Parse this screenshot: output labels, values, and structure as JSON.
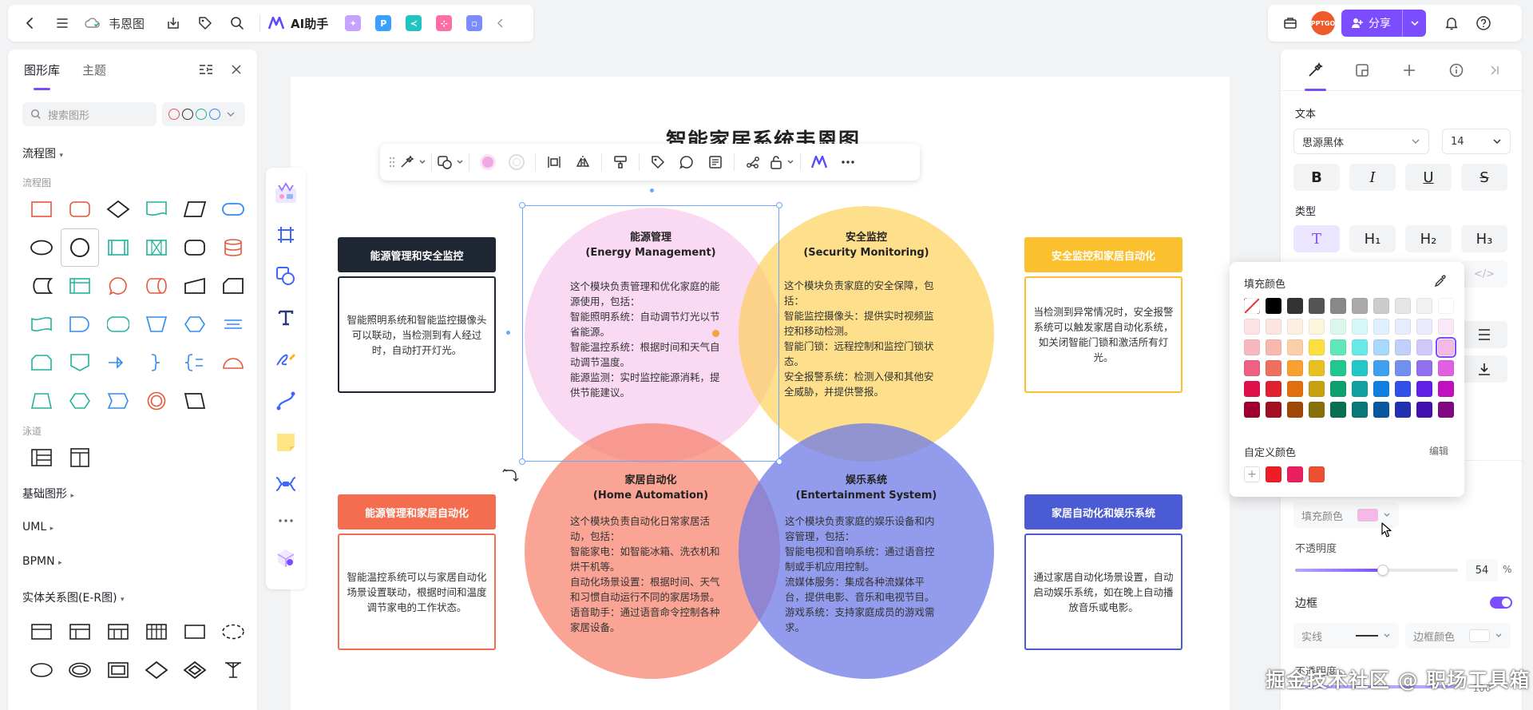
{
  "topbar": {
    "doc_title": "韦恩图",
    "ai_label": "AI助手"
  },
  "share": {
    "label": "分享"
  },
  "avatar": {
    "text": "PPTGO"
  },
  "left_panel": {
    "tabs": [
      "图形库",
      "主题"
    ],
    "search_placeholder": "搜索图形",
    "sections": {
      "flowchart": "流程图",
      "flowchart_sub": "流程图",
      "swimlane": "泳道",
      "basic": "基础图形",
      "uml": "UML",
      "bpmn": "BPMN",
      "er": "实体关系图(E-R图)"
    }
  },
  "diagram": {
    "title": "智能家居系统韦恩图",
    "circles": {
      "energy": {
        "title": "能源管理",
        "subtitle": "(Energy Management)",
        "lines": [
          "这个模块负责管理和优化家庭的能",
          "源使用，包括：",
          "智能照明系统：自动调节灯光以节",
          "省能源。",
          "智能温控系统：根据时间和天气自",
          "动调节温度。",
          "能源监测：实时监控能源消耗，提",
          "供节能建议。"
        ]
      },
      "security": {
        "title": "安全监控",
        "subtitle": "(Security Monitoring)",
        "lines": [
          "这个模块负责家庭的安全保障，包",
          "括：",
          "智能监控摄像头：提供实时视频监",
          "控和移动检测。",
          "智能门锁：远程控制和监控门锁状",
          "态。",
          "安全报警系统：检测入侵和其他安",
          "全威胁，并提供警报。"
        ]
      },
      "home": {
        "title": "家居自动化",
        "subtitle": "(Home Automation)",
        "lines": [
          "这个模块负责自动化日常家居活",
          "动，包括：",
          "智能家电：如智能冰箱、洗衣机和",
          "烘干机等。",
          "自动化场景设置：根据时间、天气",
          "和习惯自动运行不同的家居场景。",
          "语音助手：通过语音命令控制各种",
          "家居设备。"
        ]
      },
      "entertainment": {
        "title": "娱乐系统",
        "subtitle": "(Entertainment System)",
        "lines": [
          "这个模块负责家庭的娱乐设备和内",
          "容管理，包括：",
          "智能电视和音响系统：通过语音控",
          "制或手机应用控制。",
          "流媒体服务：集成各种流媒体平",
          "台，提供电影、音乐和电视节目。",
          "游戏系统：支持家庭成员的游戏需",
          "求。"
        ]
      }
    },
    "cards": {
      "tl": {
        "header": "能源管理和安全监控",
        "lines": [
          "智能照明系统和智能监控摄像头",
          "可以联动，当检测到有人经过",
          "时，自动打开灯光。"
        ]
      },
      "tr": {
        "header": "安全监控和家居自动化",
        "lines": [
          "当检测到异常情况时，安全报警",
          "系统可以触发家居自动化系统，",
          "如关闭智能门锁和激活所有灯",
          "光。"
        ]
      },
      "bl": {
        "header": "能源管理和家居自动化",
        "lines": [
          "智能温控系统可以与家居自动化",
          "场景设置联动，根据时间和温度",
          "调节家电的工作状态。"
        ]
      },
      "br": {
        "header": "家居自动化和娱乐系统",
        "lines": [
          "通过家居自动化场景设置，自动",
          "启动娱乐系统，如在晚上自动播",
          "放音乐或电影。"
        ]
      }
    }
  },
  "right_panel": {
    "text_label": "文本",
    "font_family": "思源黑体",
    "font_size": "14",
    "type_label": "类型",
    "type_buttons": [
      "T",
      "H₁",
      "H₂",
      "H₃"
    ],
    "fill_color_label": "填充颜色",
    "opacity_label": "不透明度",
    "opacity_value": "54",
    "opacity_unit": "%",
    "opacity_fraction": 0.54,
    "border_label": "边框",
    "border_style": "实线",
    "border_color_label": "边框颜色",
    "opacity2_label": "不透明度",
    "opacity2_value": "100",
    "fill_swatch": "#f5b8e8"
  },
  "color_popup": {
    "title": "填充颜色",
    "custom_label": "自定义颜色",
    "edit_label": "编辑",
    "rows": [
      [
        "none",
        "#000000",
        "#333333",
        "#555555",
        "#888888",
        "#aaaaaa",
        "#cccccc",
        "#e5e5e5",
        "#f2f2f2",
        "#ffffff"
      ],
      [
        "#fde2e4",
        "#fde4e1",
        "#fdeee2",
        "#fdf6dc",
        "#dcf8ee",
        "#d8f8f8",
        "#e0f0fd",
        "#e6ecfd",
        "#ecebfd",
        "#f8e8f8"
      ],
      [
        "#f8b8c0",
        "#f8b8b0",
        "#fbd0a8",
        "#fde040",
        "#60e8b8",
        "#68e8e8",
        "#a8d8fb",
        "#c0d0fb",
        "#d0c8fb",
        "#f5b8e8"
      ],
      [
        "#f06080",
        "#f07060",
        "#f8a030",
        "#e8c020",
        "#20c890",
        "#20c8c8",
        "#40a0f0",
        "#7090f0",
        "#9070f0",
        "#e060e0"
      ],
      [
        "#e0104a",
        "#e02030",
        "#e07010",
        "#c8a010",
        "#10a070",
        "#10a0a0",
        "#1080e0",
        "#3050e8",
        "#6020e8",
        "#c010c0"
      ],
      [
        "#a00030",
        "#a01020",
        "#a04808",
        "#887008",
        "#087050",
        "#087878",
        "#0858a0",
        "#2030b0",
        "#4010b0",
        "#800880"
      ]
    ],
    "custom": [
      "#ee1c25",
      "#e82060",
      "#ec5030"
    ]
  },
  "watermark": "掘金技术社区 @ 职场工具箱"
}
